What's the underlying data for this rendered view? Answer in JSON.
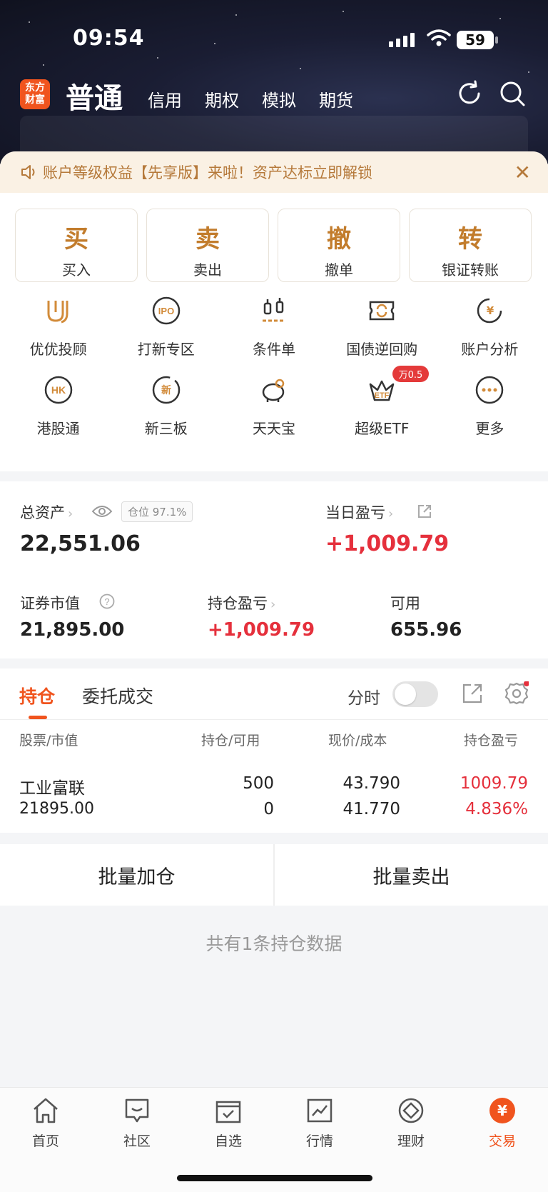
{
  "status_bar": {
    "time": "09:54",
    "battery": "59"
  },
  "nav": {
    "logo_line1": "东方",
    "logo_line2": "财富",
    "active_tab": "普通",
    "tabs": [
      "信用",
      "期权",
      "模拟",
      "期货"
    ]
  },
  "notice": {
    "text": "账户等级权益【先享版】来啦！资产达标立即解锁"
  },
  "quick_actions": [
    {
      "big": "买",
      "small": "买入"
    },
    {
      "big": "卖",
      "small": "卖出"
    },
    {
      "big": "撤",
      "small": "撤单"
    },
    {
      "big": "转",
      "small": "银证转账"
    }
  ],
  "grid": [
    {
      "label": "优优投顾",
      "icon": "uu-advisor-icon"
    },
    {
      "label": "打新专区",
      "icon": "ipo-icon"
    },
    {
      "label": "条件单",
      "icon": "conditional-order-icon"
    },
    {
      "label": "国债逆回购",
      "icon": "reverse-repo-icon"
    },
    {
      "label": "账户分析",
      "icon": "account-analysis-icon"
    },
    {
      "label": "港股通",
      "icon": "hk-connect-icon"
    },
    {
      "label": "新三板",
      "icon": "neeq-icon"
    },
    {
      "label": "天天宝",
      "icon": "piggy-bank-icon"
    },
    {
      "label": "超级ETF",
      "icon": "etf-icon",
      "badge": "万0.5"
    },
    {
      "label": "更多",
      "icon": "more-icon"
    }
  ],
  "assets": {
    "total_label": "总资产",
    "position_badge": "仓位 97.1%",
    "total_value": "22,551.06",
    "daily_pl_label": "当日盈亏",
    "daily_pl_value": "+1,009.79",
    "market_value_label": "证券市值",
    "market_value": "21,895.00",
    "holding_pl_label": "持仓盈亏",
    "holding_pl_value": "+1,009.79",
    "available_label": "可用",
    "available_value": "655.96"
  },
  "holdings": {
    "tab_positions": "持仓",
    "tab_orders": "委托成交",
    "timeshare_label": "分时",
    "columns": [
      "股票/市值",
      "持仓/可用",
      "现价/成本",
      "持仓盈亏"
    ],
    "rows": [
      {
        "name": "工业富联",
        "market_value": "21895.00",
        "position": "500",
        "available": "0",
        "price": "43.790",
        "cost": "41.770",
        "pl": "1009.79",
        "pl_pct": "4.836%"
      }
    ]
  },
  "batch": {
    "add": "批量加仓",
    "sell": "批量卖出"
  },
  "summary": "共有1条持仓数据",
  "bottom_nav": [
    {
      "label": "首页",
      "icon": "home-icon"
    },
    {
      "label": "社区",
      "icon": "community-icon"
    },
    {
      "label": "自选",
      "icon": "watchlist-icon"
    },
    {
      "label": "行情",
      "icon": "market-icon"
    },
    {
      "label": "理财",
      "icon": "wealth-icon"
    },
    {
      "label": "交易",
      "icon": "trade-icon",
      "active": true
    }
  ],
  "colors": {
    "accent": "#f0541e",
    "gold": "#c27c2c",
    "profit_red": "#e5303c"
  }
}
